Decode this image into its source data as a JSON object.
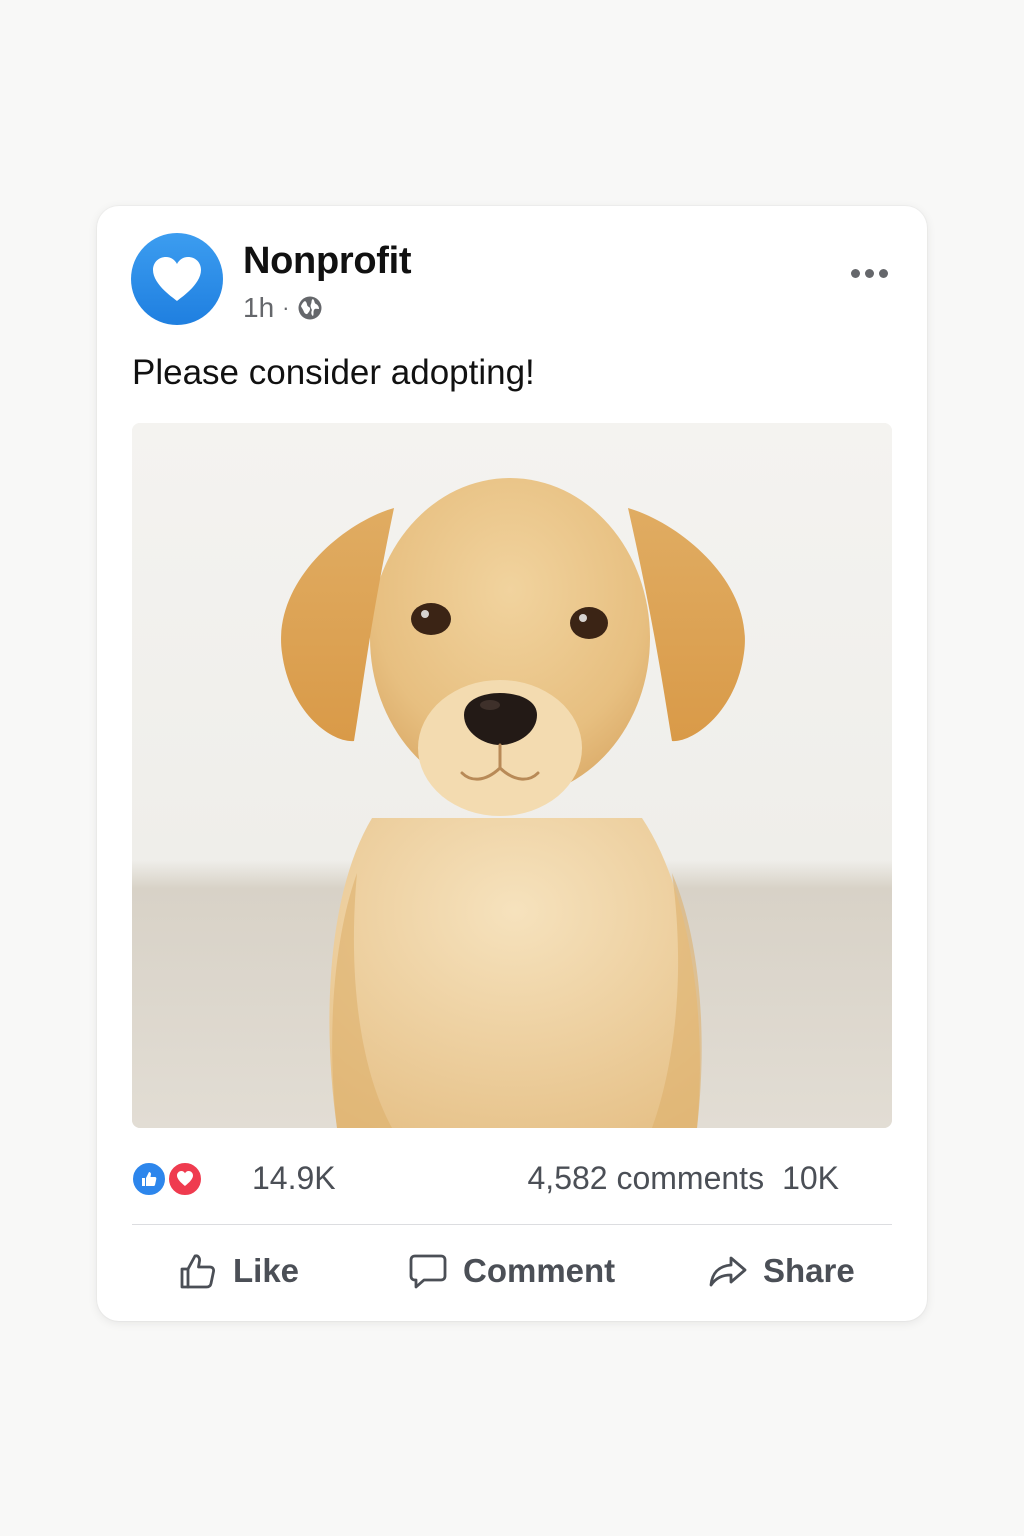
{
  "post": {
    "author": "Nonprofit",
    "time": "1h",
    "separator": "·",
    "audience_icon": "globe-icon",
    "text": "Please consider adopting!",
    "photo_subject": "puppy",
    "more_icon": "more-dots-icon"
  },
  "stats": {
    "reaction_icons": [
      "like-reaction-icon",
      "love-reaction-icon"
    ],
    "reaction_count": "14.9K",
    "comments": "4,582 comments",
    "shares": "10K"
  },
  "actions": {
    "like": "Like",
    "comment": "Comment",
    "share": "Share"
  },
  "colors": {
    "accent_blue": "#1f7fe0",
    "love_red": "#ef3b4f",
    "text_primary": "#111111",
    "text_secondary": "#65676b"
  }
}
